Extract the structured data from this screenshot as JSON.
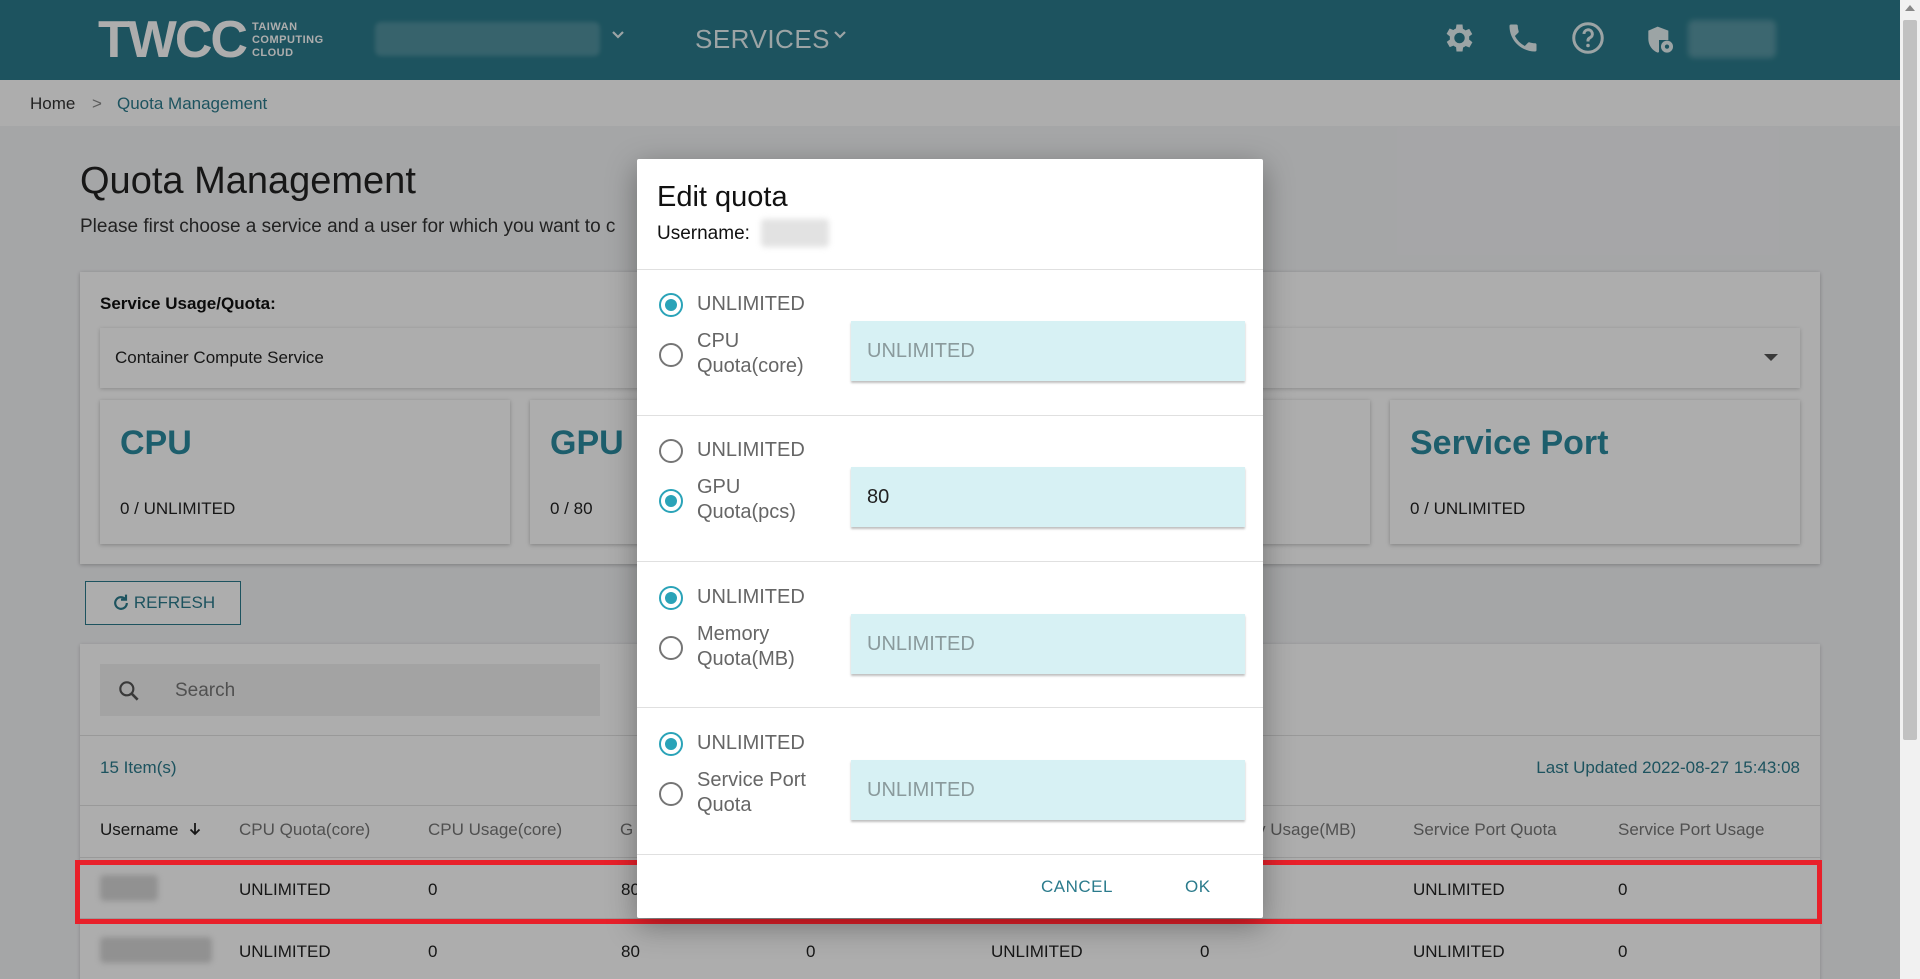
{
  "header": {
    "logo_main": "TWCC",
    "logo_sub": [
      "TAIWAN",
      "COMPUTING",
      "CLOUD"
    ],
    "services_label": "SERVICES"
  },
  "breadcrumb": {
    "home": "Home",
    "separator": ">",
    "current": "Quota Management"
  },
  "page": {
    "title": "Quota Management",
    "description": "Please first choose a service and a user for which you want to c"
  },
  "usage": {
    "label": "Service Usage/Quota:",
    "selected_service": "Container Compute Service",
    "stats": [
      {
        "name": "CPU",
        "value": "0 / UNLIMITED"
      },
      {
        "name": "GPU",
        "value": "0 / 80"
      },
      {
        "name": "Service Port",
        "value": "0 / UNLIMITED"
      }
    ]
  },
  "refresh_label": "REFRESH",
  "table": {
    "search_placeholder": "Search",
    "items_count": "15 Item(s)",
    "last_updated": "Last Updated 2022-08-27 15:43:08",
    "columns": [
      "Username",
      "CPU Quota(core)",
      "CPU Usage(core)",
      "G",
      "y Usage(MB)",
      "Service Port Quota",
      "Service Port Usage"
    ],
    "rows": [
      {
        "cpu_quota": "UNLIMITED",
        "cpu_usage": "0",
        "gpu_quota": "80",
        "sp_quota": "UNLIMITED",
        "sp_usage": "0"
      },
      {
        "cpu_quota": "UNLIMITED",
        "cpu_usage": "0",
        "gpu_quota": "80",
        "gpu_usage": "0",
        "mem_quota": "UNLIMITED",
        "mem_usage": "0",
        "sp_quota": "UNLIMITED",
        "sp_usage": "0"
      }
    ]
  },
  "dialog": {
    "title": "Edit quota",
    "username_label": "Username:",
    "unlimited_label": "UNLIMITED",
    "sections": [
      {
        "label_line1": "CPU",
        "label_line2": "Quota(core)",
        "unlimited_selected": true,
        "value": "",
        "placeholder": "UNLIMITED"
      },
      {
        "label_line1": "GPU",
        "label_line2": "Quota(pcs)",
        "unlimited_selected": false,
        "value": "80",
        "placeholder": "UNLIMITED"
      },
      {
        "label_line1": "Memory",
        "label_line2": "Quota(MB)",
        "unlimited_selected": true,
        "value": "",
        "placeholder": "UNLIMITED"
      },
      {
        "label_line1": "Service Port",
        "label_line2": "Quota",
        "unlimited_selected": true,
        "value": "",
        "placeholder": "UNLIMITED"
      }
    ],
    "cancel_label": "CANCEL",
    "ok_label": "OK"
  },
  "colors": {
    "primary": "#2b7b8c",
    "accent": "#2aa3b8",
    "highlight": "#e8202a",
    "input_bg": "#d7f1f4"
  }
}
